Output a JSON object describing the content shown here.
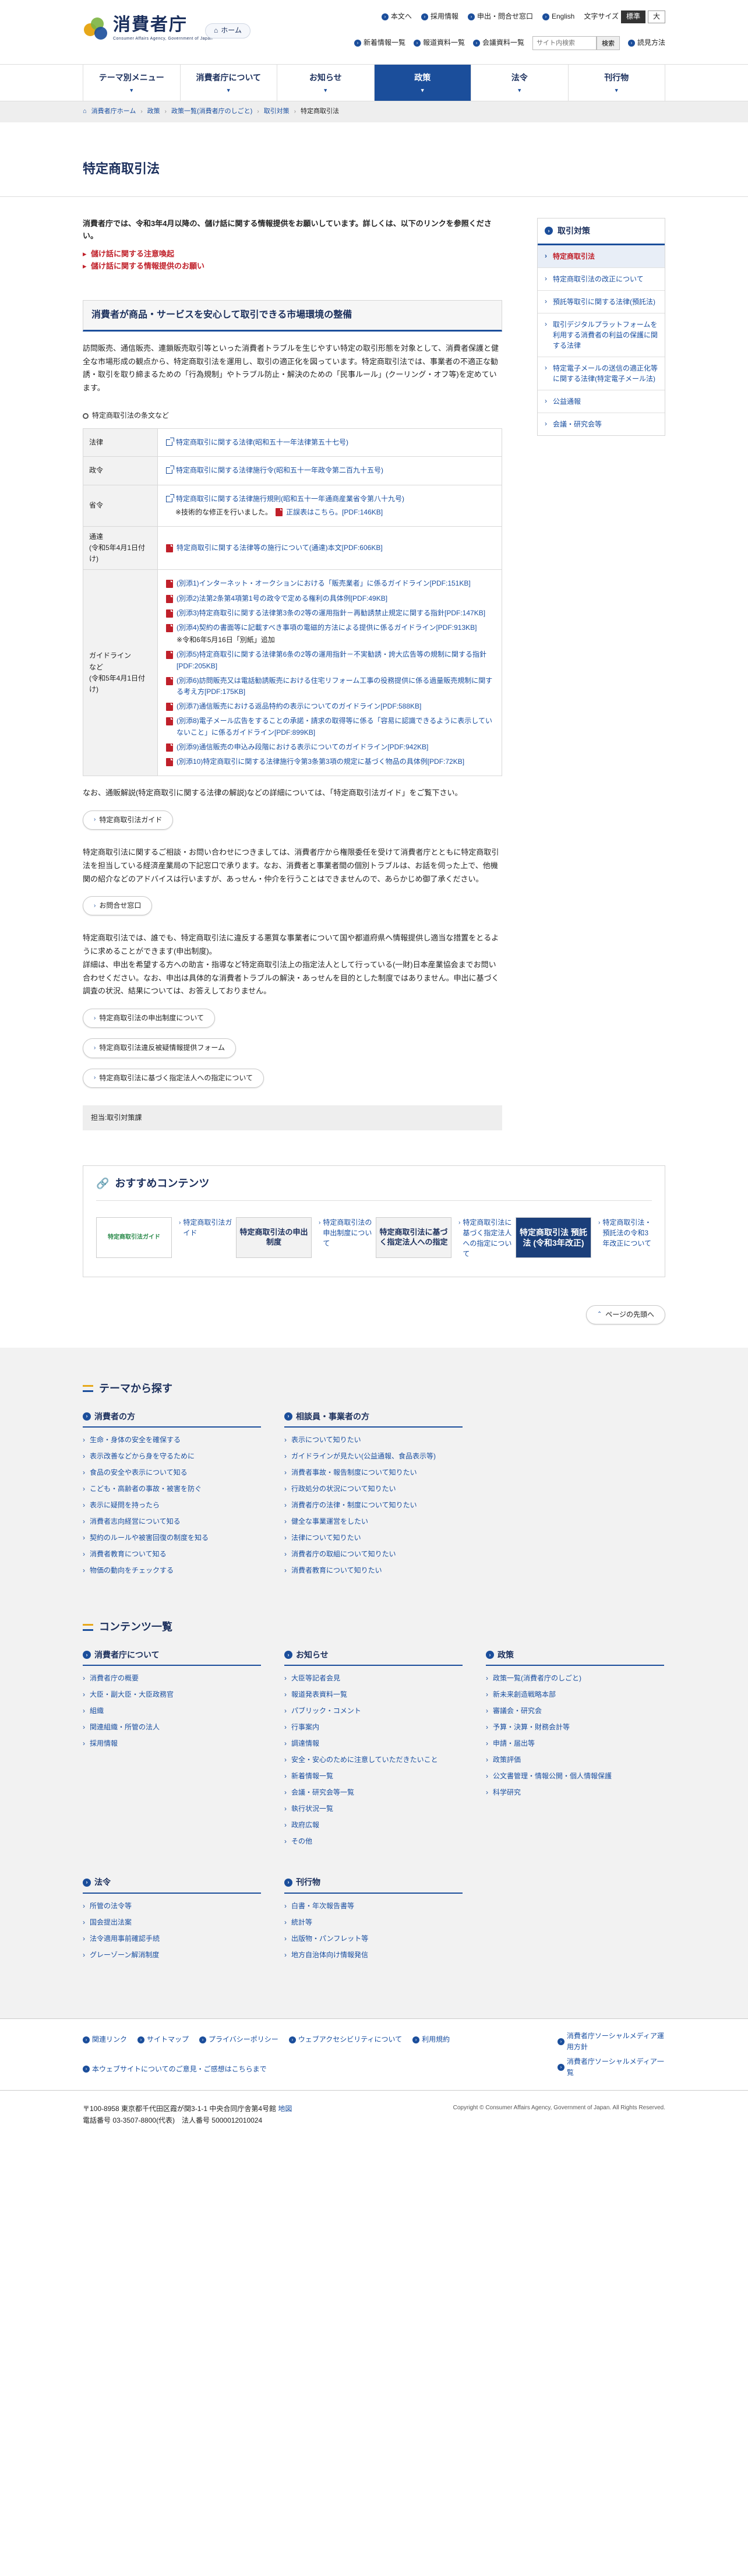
{
  "header": {
    "logo_text": "消費者庁",
    "logo_sub": "Consumer Affairs Agency, Government of Japan",
    "home_label": "ホーム",
    "top_links": [
      "本文へ",
      "採用情報",
      "申出・問合せ窓口",
      "English"
    ],
    "fontsize_label": "文字サイズ",
    "fontsize_options": [
      "標準",
      "大"
    ],
    "sub_links": [
      "新着情報一覧",
      "報道資料一覧",
      "会議資料一覧"
    ],
    "search_placeholder": "サイト内検索",
    "search_button": "検索",
    "readaloud": "読見方法"
  },
  "gnav": [
    "テーマ別メニュー",
    "消費者庁について",
    "お知らせ",
    "政策",
    "法令",
    "刊行物"
  ],
  "breadcrumb": [
    "消費者庁ホーム",
    "政策",
    "政策一覧(消費者庁のしごと)",
    "取引対策",
    "特定商取引法"
  ],
  "page_title": "特定商取引法",
  "notice": {
    "text": "消費者庁では、令和3年4月以降の、儲け話に関する情報提供をお願いしています。詳しくは、以下のリンクを参照ください。",
    "links": [
      "儲け話に関する注意喚起",
      "儲け話に関する情報提供のお願い"
    ]
  },
  "h2": "消費者が商品・サービスを安心して取引できる市場環境の整備",
  "intro": "訪問販売、通信販売、連鎖販売取引等といった消費者トラブルを生じやすい特定の取引形態を対象として、消費者保護と健全な市場形成の観点から、特定商取引法を運用し、取引の適正化を図っています。特定商取引法では、事業者の不適正な勧誘・取引を取り締まるための「行為規制」やトラブル防止・解決のための「民事ルール」(クーリング・オフ等)を定めています。",
  "section_label": "特定商取引法の条文など",
  "law_table": {
    "rows": [
      {
        "head": "法律",
        "items": [
          {
            "icon": "ext",
            "text": "特定商取引に関する法律(昭和五十一年法律第五十七号)"
          }
        ]
      },
      {
        "head": "政令",
        "items": [
          {
            "icon": "ext",
            "text": "特定商取引に関する法律施行令(昭和五十一年政令第二百九十五号)"
          }
        ]
      },
      {
        "head": "省令",
        "items": [
          {
            "icon": "ext",
            "text": "特定商取引に関する法律施行規則(昭和五十一年通商産業省令第八十九号)"
          }
        ],
        "note": "※技術的な修正を行いました。",
        "note_link": "正誤表はこちら。[PDF:146KB]"
      },
      {
        "head": "通達\n(令和5年4月1日付け)",
        "items": [
          {
            "icon": "pdf",
            "text": "特定商取引に関する法律等の施行について(通達)本文[PDF:606KB]"
          }
        ]
      },
      {
        "head": "ガイドライン\nなど\n(令和5年4月1日付け)",
        "items": [
          {
            "icon": "pdf",
            "text": "(別添1)インターネット・オークションにおける「販売業者」に係るガイドライン[PDF:151KB]"
          },
          {
            "icon": "pdf",
            "text": "(別添2)法第2条第4項第1号の政令で定める権利の具体例[PDF:49KB]"
          },
          {
            "icon": "pdf",
            "text": "(別添3)特定商取引に関する法律第3条の2等の運用指針－再勧誘禁止規定に関する指針[PDF:147KB]"
          },
          {
            "icon": "pdf",
            "text": "(別添4)契約の書面等に記載すべき事項の電磁的方法による提供に係るガイドライン[PDF:913KB]"
          },
          {
            "icon": "none",
            "text": "※令和6年5月16日「別紙」追加"
          },
          {
            "icon": "pdf",
            "text": "(別添5)特定商取引に関する法律第6条の2等の運用指針－不実勧誘・誇大広告等の規制に関する指針[PDF:205KB]"
          },
          {
            "icon": "pdf",
            "text": "(別添6)訪問販売又は電話勧誘販売における住宅リフォーム工事の役務提供に係る過量販売規制に関する考え方[PDF:175KB]"
          },
          {
            "icon": "pdf",
            "text": "(別添7)通信販売における返品特約の表示についてのガイドライン[PDF:588KB]"
          },
          {
            "icon": "pdf",
            "text": "(別添8)電子メール広告をすることの承諾・請求の取得等に係る「容易に認識できるように表示していないこと」に係るガイドライン[PDF:899KB]"
          },
          {
            "icon": "pdf",
            "text": "(別添9)通信販売の申込み段階における表示についてのガイドライン[PDF:942KB]"
          },
          {
            "icon": "pdf",
            "text": "(別添10)特定商取引に関する法律施行令第3条第3項の規定に基づく物品の具体例[PDF:72KB]"
          }
        ]
      }
    ]
  },
  "guide_text": "なお、通販解説(特定商取引に関する法律の解説)などの詳細については、「特定商取引法ガイド」をご覧下さい。",
  "guide_button": "特定商取引法ガイド",
  "consult_text": "特定商取引法に関するご相談・お問い合わせにつきましては、消費者庁から権限委任を受けて消費者庁とともに特定商取引法を担当している経済産業局の下記窓口で承ります。なお、消費者と事業者間の個別トラブルは、お話を伺った上で、他機関の紹介などのアドバイスは行いますが、あっせん・仲介を行うことはできませんので、あらかじめ御了承ください。",
  "consult_button": "お問合せ窓口",
  "report_text": "特定商取引法では、誰でも、特定商取引法に違反する悪質な事業者について国や都道府県へ情報提供し適当な措置をとるように求めることができます(申出制度)。\n詳細は、申出を希望する方への助言・指導など特定商取引法上の指定法人として行っている(一財)日本産業協会までお問い合わせください。なお、申出は具体的な消費者トラブルの解決・あっせんを目的とした制度ではありません。申出に基づく調査の状況、結果については、お答えしておりません。",
  "report_buttons": [
    "特定商取引法の申出制度について",
    "特定商取引法違反被疑情報提供フォーム",
    "特定商取引法に基づく指定法人への指定について"
  ],
  "dept": "担当:取引対策課",
  "sidebar": {
    "title": "取引対策",
    "items": [
      "特定商取引法",
      "特定商取引法の改正について",
      "預託等取引に関する法律(預託法)",
      "取引デジタルプラットフォームを利用する消費者の利益の保護に関する法律",
      "特定電子メールの送信の適正化等に関する法律(特定電子メール法)",
      "公益通報",
      "会議・研究会等"
    ]
  },
  "recommend": {
    "title": "おすすめコンテンツ",
    "items": [
      {
        "thumb": "特定商取引法ガイド",
        "thumb_style": "light",
        "link": "特定商取引法ガイド"
      },
      {
        "thumb": "特定商取引法の申出制度",
        "thumb_style": "gray",
        "link": "特定商取引法の申出制度について"
      },
      {
        "thumb": "特定商取引法に基づく指定法人への指定",
        "thumb_style": "gray",
        "link": "特定商取引法に基づく指定法人への指定について"
      },
      {
        "thumb": "特定商取引法 預託法 (令和3年改正)",
        "thumb_style": "dark",
        "link": "特定商取引法・預託法の令和3年改正について"
      }
    ]
  },
  "pagetop": "ページの先頭へ",
  "footer": {
    "theme_title": "テーマから探す",
    "theme_cols": [
      {
        "title": "消費者の方",
        "items": [
          "生命・身体の安全を確保する",
          "表示改善などから身を守るために",
          "食品の安全や表示について知る",
          "こども・高齢者の事故・被害を防ぐ",
          "表示に疑問を持ったら",
          "消費者志向経営について知る",
          "契約のルールや被害回復の制度を知る",
          "消費者教育について知る",
          "物価の動向をチェックする"
        ]
      },
      {
        "title": "相談員・事業者の方",
        "items": [
          "表示について知りたい",
          "ガイドラインが見たい(公益通報、食品表示等)",
          "消費者事故・報告制度について知りたい",
          "行政処分の状況について知りたい",
          "消費者庁の法律・制度について知りたい",
          "健全な事業運営をしたい",
          "法律について知りたい",
          "消費者庁の取組について知りたい",
          "消費者教育について知りたい"
        ]
      }
    ],
    "content_title": "コンテンツ一覧",
    "content_cols": [
      {
        "title": "消費者庁について",
        "items": [
          "消費者庁の概要",
          "大臣・副大臣・大臣政務官",
          "組織",
          "関連組織・所管の法人",
          "採用情報"
        ]
      },
      {
        "title": "お知らせ",
        "items": [
          "大臣等記者会見",
          "報道発表資料一覧",
          "パブリック・コメント",
          "行事案内",
          "調達情報",
          "安全・安心のために注意していただきたいこと",
          "新着情報一覧",
          "会議・研究会等一覧",
          "執行状況一覧",
          "政府広報",
          "その他"
        ]
      },
      {
        "title": "政策",
        "items": [
          "政策一覧(消費者庁のしごと)",
          "新未来創造戦略本部",
          "審議会・研究会",
          "予算・決算・財務会計等",
          "申請・届出等",
          "政策評価",
          "公文書管理・情報公開・個人情報保護",
          "科学研究"
        ]
      }
    ],
    "content_cols2": [
      {
        "title": "法令",
        "items": [
          "所管の法令等",
          "国会提出法案",
          "法令適用事前確認手続",
          "グレーゾーン解消制度"
        ]
      },
      {
        "title": "刊行物",
        "items": [
          "白書・年次報告書等",
          "統計等",
          "出版物・パンフレット等",
          "地方自治体向け情報発信"
        ]
      }
    ],
    "links_left": [
      "関連リンク",
      "サイトマップ",
      "プライバシーポリシー",
      "ウェブアクセシビリティについて",
      "利用規約",
      "本ウェブサイトについてのご意見・ご感想はこちらまで"
    ],
    "links_right": [
      "消費者庁ソーシャルメディア運用方針",
      "消費者庁ソーシャルメディア一覧"
    ],
    "address": "〒100-8958 東京都千代田区霞が関3-1-1 中央合同庁舎第4号館",
    "map_label": "地図",
    "tel": "電話番号 03-3507-8800(代表)　法人番号 5000012010024",
    "copyright": "Copyright © Consumer Affairs Agency, Government of Japan. All Rights Reserved."
  },
  "colors": {
    "brand": "#1b4e9b",
    "alert": "#c0202a",
    "accent": "#e7a81a"
  }
}
